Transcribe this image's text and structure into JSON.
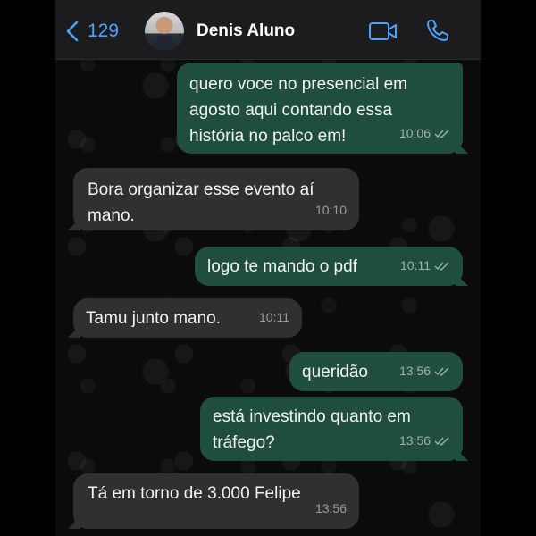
{
  "header": {
    "back_count": "129",
    "contact_name": "Denis Aluno"
  },
  "messages": [
    {
      "direction": "out",
      "text": "quero voce no presencial em\nagosto aqui contando essa\nhistória no palco em!",
      "time": "10:06",
      "read": true
    },
    {
      "direction": "in",
      "text": "Bora organizar esse evento aí\nmano.",
      "time": "10:10"
    },
    {
      "direction": "out",
      "text": "logo te mando o pdf",
      "time": "10:11",
      "read": true
    },
    {
      "direction": "in",
      "text": "Tamu junto mano.",
      "time": "10:11"
    },
    {
      "direction": "out",
      "text": "queridão",
      "time": "13:56",
      "read": true
    },
    {
      "direction": "out",
      "text": "está investindo quanto em\ntráfego?",
      "time": "13:56",
      "read": true
    },
    {
      "direction": "in",
      "text": "Tá em torno de 3.000 Felipe",
      "time": "13:56"
    }
  ],
  "colors": {
    "accent": "#4aa3ff",
    "outgoing_bubble": "#1f4e3d",
    "incoming_bubble": "#303032",
    "background": "#0b0b0b"
  },
  "icons": [
    "chevron-left-icon",
    "video-camera-icon",
    "phone-icon",
    "double-check-icon"
  ]
}
